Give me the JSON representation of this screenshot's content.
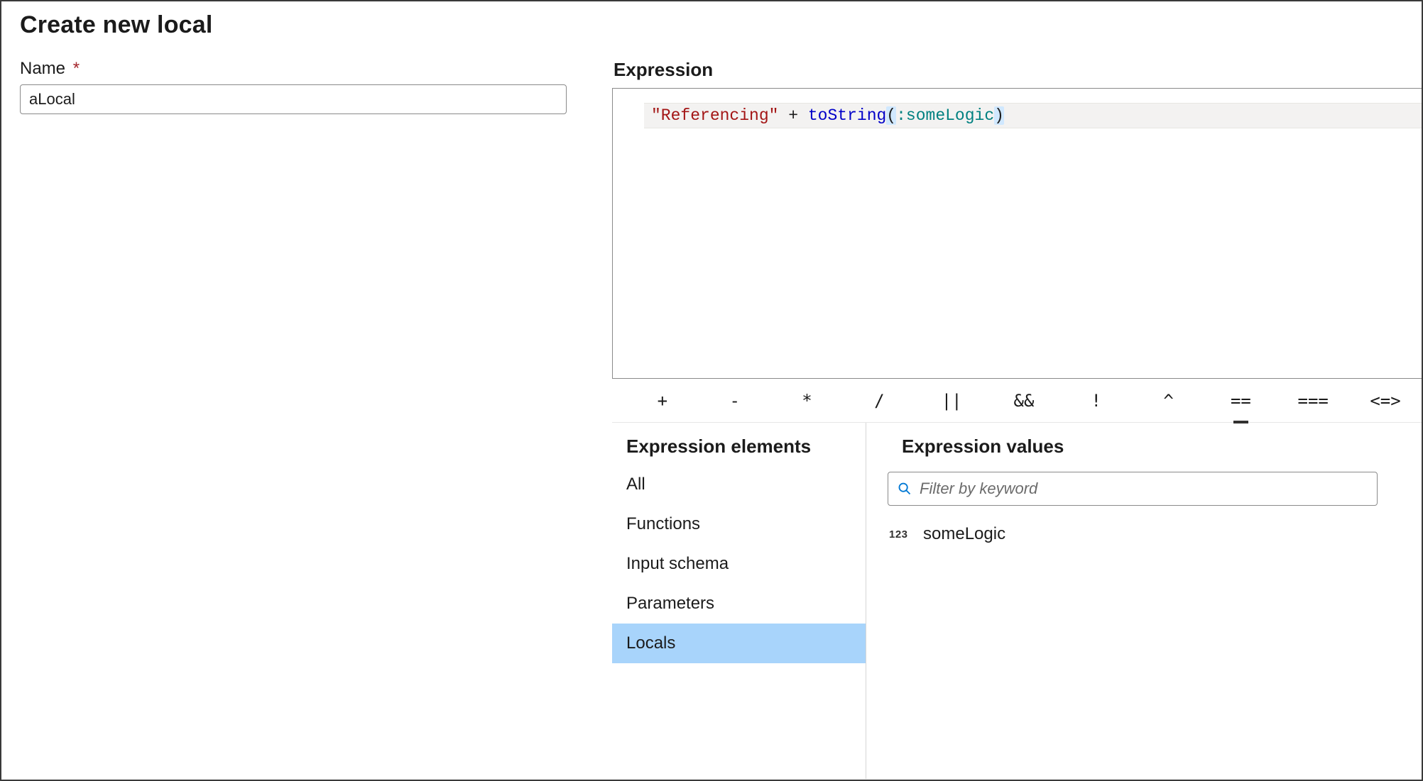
{
  "header": {
    "title": "Create new local"
  },
  "name": {
    "label": "Name",
    "required_marker": "*",
    "value": "aLocal"
  },
  "expression": {
    "label": "Expression",
    "tokens": {
      "string_literal": "\"Referencing\"",
      "space1": " ",
      "plus": "+",
      "space2": " ",
      "fn": "toString",
      "lparen": "(",
      "colon": ":",
      "ident": "someLogic",
      "rparen": ")"
    }
  },
  "operators": [
    {
      "symbol": "+",
      "active": false
    },
    {
      "symbol": "-",
      "active": false
    },
    {
      "symbol": "*",
      "active": false
    },
    {
      "symbol": "/",
      "active": false
    },
    {
      "symbol": "||",
      "active": false
    },
    {
      "symbol": "&&",
      "active": false
    },
    {
      "symbol": "!",
      "active": false
    },
    {
      "symbol": "^",
      "active": false
    },
    {
      "symbol": "==",
      "active": true
    },
    {
      "symbol": "===",
      "active": false
    },
    {
      "symbol": "<=>",
      "active": false
    }
  ],
  "elements": {
    "title": "Expression elements",
    "items": [
      {
        "label": "All",
        "selected": false
      },
      {
        "label": "Functions",
        "selected": false
      },
      {
        "label": "Input schema",
        "selected": false
      },
      {
        "label": "Parameters",
        "selected": false
      },
      {
        "label": "Locals",
        "selected": true
      }
    ]
  },
  "values": {
    "title": "Expression values",
    "search_placeholder": "Filter by keyword",
    "items": [
      {
        "type_badge": "123",
        "name": "someLogic"
      }
    ]
  }
}
